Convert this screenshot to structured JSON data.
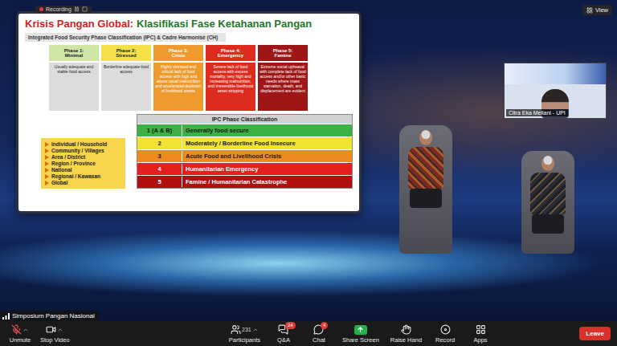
{
  "meeting": {
    "name": "Simposium Pangan Nasional",
    "recording_label": "Recording",
    "view_button": "View"
  },
  "slide": {
    "title_red": "Krisis Pangan Global:",
    "title_green": "Klasifikasi Fase Ketahanan Pangan",
    "subheader": "Integrated Food Security Phase Classification (IPC) & Cadre Harmonisé (CH)",
    "phases": [
      {
        "label": "Phase 1:",
        "name": "Minimal",
        "color": "#cfe6a6",
        "light": true,
        "description": "Usually adequate and stable food access"
      },
      {
        "label": "Phase 2:",
        "name": "Stressed",
        "color": "#f6e04a",
        "light": true,
        "description": "Borderline adequate food access"
      },
      {
        "label": "Phase 3:",
        "name": "Crisis",
        "color": "#ee9a2c",
        "light": false,
        "description": "Highly stressed and critical lack of food access with high and above usual malnutrition and accelerated depletion of livelihood assets"
      },
      {
        "label": "Phase 4:",
        "name": "Emergency",
        "color": "#dd2c1e",
        "light": false,
        "description": "Severe lack of food access with excess mortality, very high and increasing malnutrition, and irreversible livelihood asset stripping"
      },
      {
        "label": "Phase 5:",
        "name": "Famine",
        "color": "#9e1616",
        "light": false,
        "description": "Extreme social upheaval with complete lack of food access and/or other basic needs where mass starvation, death, and displacement are evident"
      }
    ],
    "levels": [
      "Individual / Household",
      "Community / Villages",
      "Area / District",
      "Region / Province",
      "National",
      "Regional / Kawasan",
      "Global"
    ],
    "table": {
      "title": "IPC Phase Classification",
      "rows": [
        {
          "phase": "1 (A & B)",
          "label": "Generally food secure",
          "color": "#3db244",
          "light": true
        },
        {
          "phase": "2",
          "label": "Moderately / Borderline Food Insecure",
          "color": "#f2e232",
          "light": true
        },
        {
          "phase": "3",
          "label": "Acute Food and Livelihood Crisis",
          "color": "#ef8a1e",
          "light": true
        },
        {
          "phase": "4",
          "label": "Humanitarian Emergency",
          "color": "#e22020",
          "light": false
        },
        {
          "phase": "5",
          "label": "Famine / Humanitarian Catastrophe",
          "color": "#b01010",
          "light": false
        }
      ]
    }
  },
  "speaker_video": {
    "name": "Citra Eka Meliani - UPI"
  },
  "toolbar": {
    "left": [
      {
        "kind": "mic",
        "label": "Unmute",
        "caret": true,
        "muted": true
      },
      {
        "kind": "video",
        "label": "Stop Video",
        "caret": true,
        "muted": false
      }
    ],
    "center": [
      {
        "kind": "participants",
        "label": "Participants",
        "count": "231",
        "badge": "",
        "caret": true
      },
      {
        "kind": "qa",
        "label": "Q&A",
        "count": "",
        "badge": "24",
        "caret": false
      },
      {
        "kind": "chat",
        "label": "Chat",
        "count": "",
        "badge": "4",
        "caret": false
      },
      {
        "kind": "share",
        "label": "Share Screen",
        "count": "",
        "badge": "",
        "caret": false
      },
      {
        "kind": "hand",
        "label": "Raise Hand",
        "count": "",
        "badge": "",
        "caret": false
      },
      {
        "kind": "record",
        "label": "Record",
        "count": "",
        "badge": "",
        "caret": false
      },
      {
        "kind": "apps",
        "label": "Apps",
        "count": "",
        "badge": "",
        "caret": false
      }
    ],
    "leave": "Leave"
  }
}
